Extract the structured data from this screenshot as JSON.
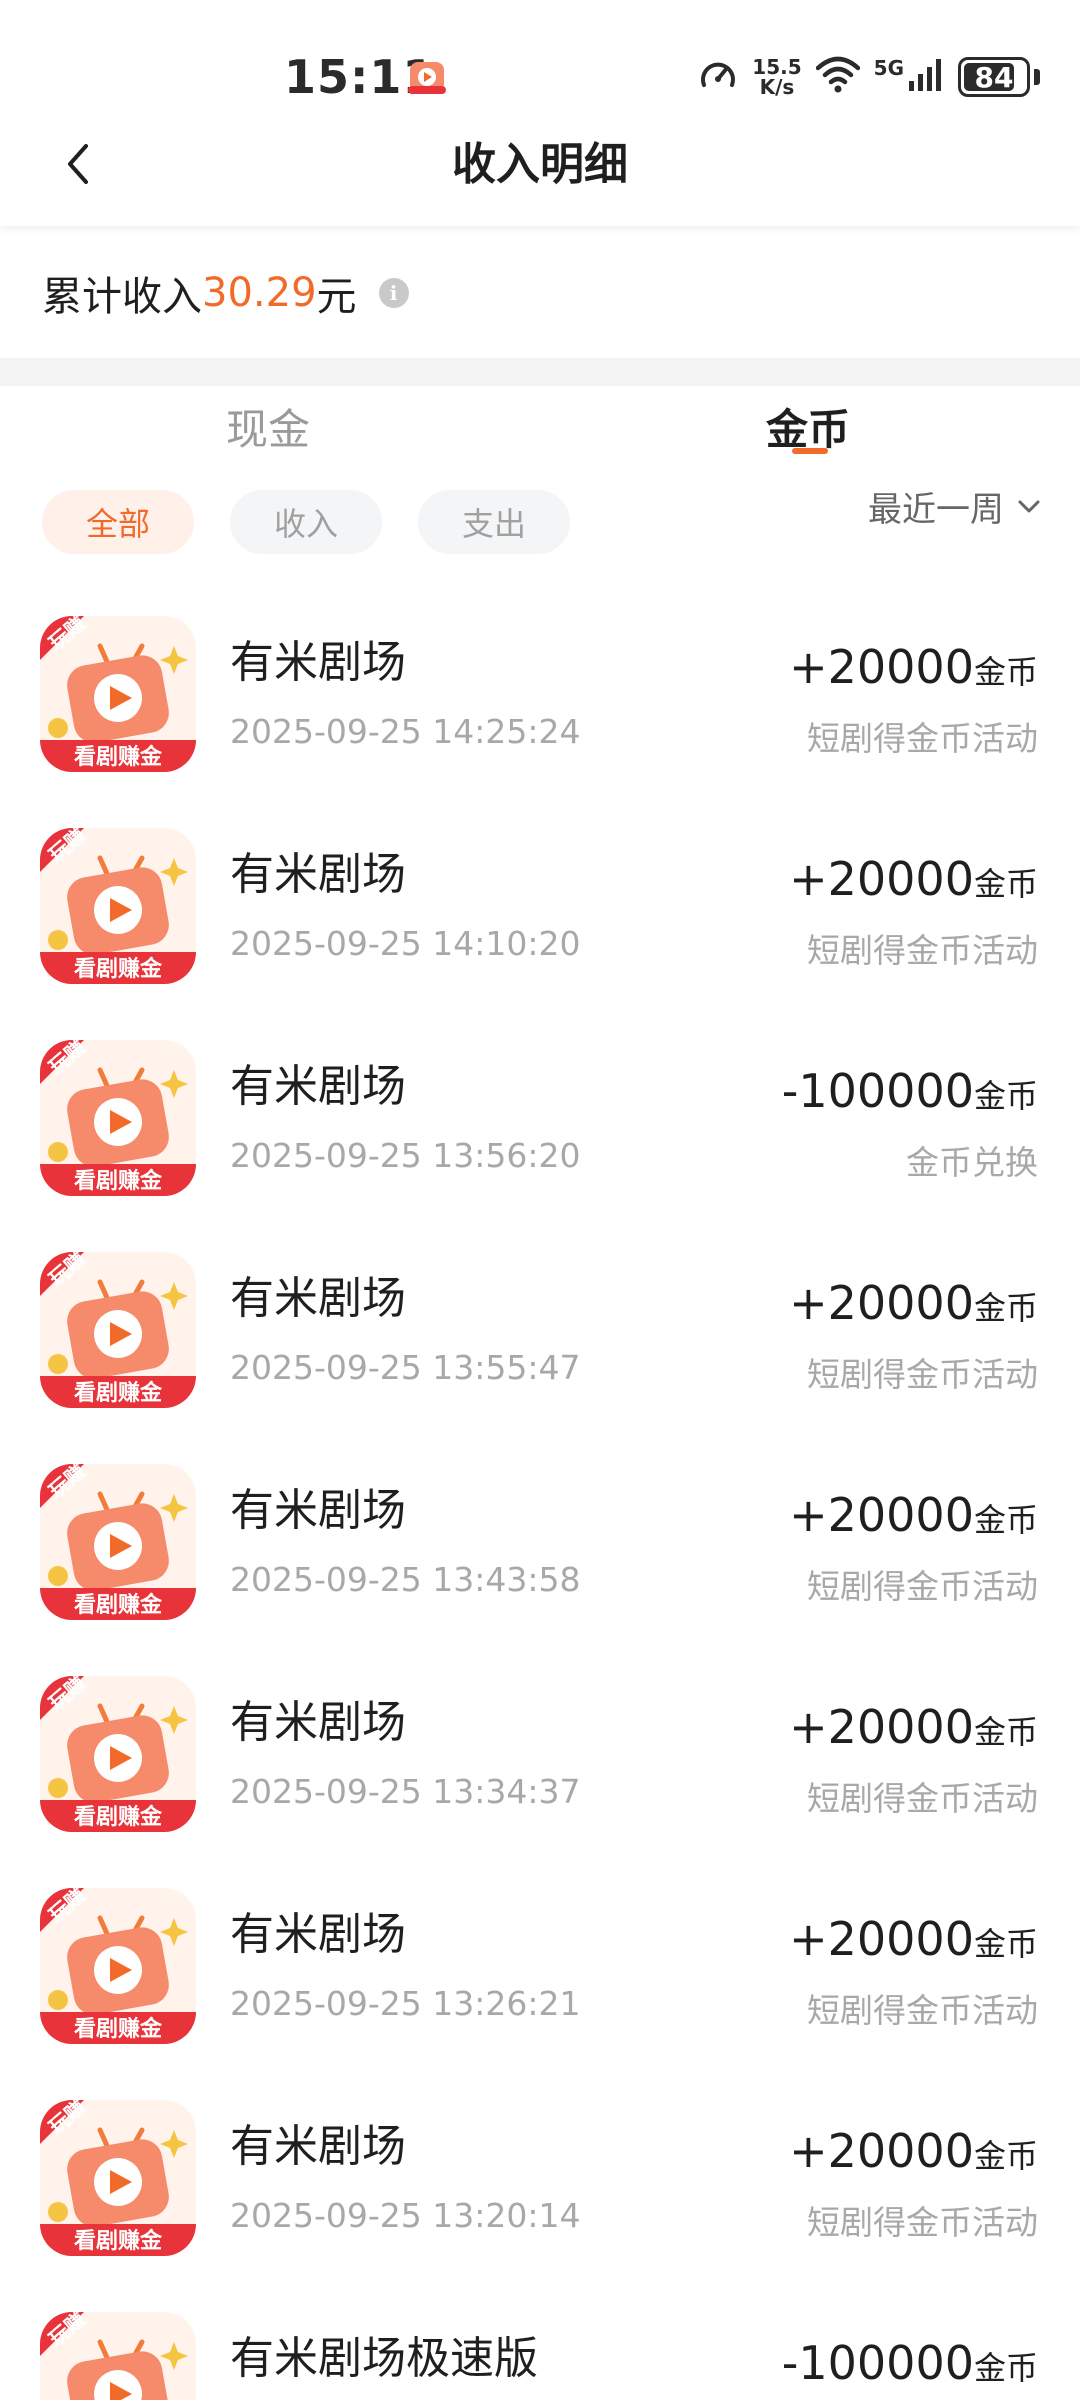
{
  "status_bar": {
    "time": "15:11",
    "net_speed_value": "15.5",
    "net_speed_unit": "K/s",
    "network": "5G",
    "battery": "84",
    "battery_level": 0.84
  },
  "header": {
    "title": "收入明细"
  },
  "summary": {
    "label": "累计收入",
    "amount": "30.29",
    "unit": "元",
    "info_icon": "i"
  },
  "tabs": [
    {
      "label": "现金",
      "active": false
    },
    {
      "label": "金币",
      "active": true
    }
  ],
  "filters": [
    {
      "label": "全部",
      "active": true
    },
    {
      "label": "收入",
      "active": false
    },
    {
      "label": "支出",
      "active": false
    }
  ],
  "period": {
    "label": "最近一周"
  },
  "transactions": [
    {
      "name": "有米剧场",
      "time": "2025-09-25 14:25:24",
      "amount": "+20000",
      "unit": "金币",
      "desc": "短剧得金币活动"
    },
    {
      "name": "有米剧场",
      "time": "2025-09-25 14:10:20",
      "amount": "+20000",
      "unit": "金币",
      "desc": "短剧得金币活动"
    },
    {
      "name": "有米剧场",
      "time": "2025-09-25 13:56:20",
      "amount": "-100000",
      "unit": "金币",
      "desc": "金币兑换"
    },
    {
      "name": "有米剧场",
      "time": "2025-09-25 13:55:47",
      "amount": "+20000",
      "unit": "金币",
      "desc": "短剧得金币活动"
    },
    {
      "name": "有米剧场",
      "time": "2025-09-25 13:43:58",
      "amount": "+20000",
      "unit": "金币",
      "desc": "短剧得金币活动"
    },
    {
      "name": "有米剧场",
      "time": "2025-09-25 13:34:37",
      "amount": "+20000",
      "unit": "金币",
      "desc": "短剧得金币活动"
    },
    {
      "name": "有米剧场",
      "time": "2025-09-25 13:26:21",
      "amount": "+20000",
      "unit": "金币",
      "desc": "短剧得金币活动"
    },
    {
      "name": "有米剧场",
      "time": "2025-09-25 13:20:14",
      "amount": "+20000",
      "unit": "金币",
      "desc": "短剧得金币活动"
    },
    {
      "name": "有米剧场极速版",
      "time": "",
      "amount": "-100000",
      "unit": "金币",
      "desc": ""
    }
  ],
  "app_icon": {
    "badge": "玩赚",
    "banner": "看剧赚金"
  },
  "colors": {
    "accent": "#f26a2a",
    "icon_red": "#e8333a"
  }
}
